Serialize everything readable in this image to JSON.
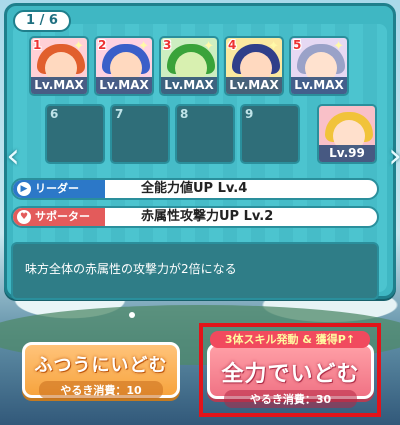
{
  "page_indicator": "1 / 6",
  "nav": {
    "left_arrow": "‹",
    "right_arrow": "›"
  },
  "members": [
    {
      "number": "1",
      "level": "Lv.MAX",
      "hair": "#e15f2d",
      "face": "#ffd9bf",
      "bg": "#ffd0d6"
    },
    {
      "number": "2",
      "level": "Lv.MAX",
      "hair": "#3a5fc9",
      "face": "#ffd9bf",
      "bg": "#ffd2e1"
    },
    {
      "number": "3",
      "level": "Lv.MAX",
      "hair": "#3aa33a",
      "face": "#d8f0b0",
      "bg": "#cdeec1"
    },
    {
      "number": "4",
      "level": "Lv.MAX",
      "hair": "#2f3f8a",
      "face": "#ffd9bf",
      "bg": "#fbe9a0"
    },
    {
      "number": "5",
      "level": "Lv.MAX",
      "hair": "#9aa2c8",
      "face": "#ffe2cf",
      "bg": "#e6d9f3"
    }
  ],
  "empty_slots": [
    "6",
    "7",
    "8",
    "9"
  ],
  "supporter_card": {
    "level": "Lv.99",
    "hair": "#f1c33a",
    "bg": "#f9c0c8"
  },
  "leader": {
    "tag": "リーダー",
    "icon": "▶",
    "skill": "全能力値UP Lv.4",
    "color": "#2c78c8"
  },
  "supporter": {
    "tag": "サポーター",
    "icon": "♥",
    "skill": "赤属性攻撃力UP Lv.2",
    "color": "#e35b5b"
  },
  "description": "味方全体の赤属性の攻撃力が2倍になる",
  "buttons": {
    "normal": {
      "label": "ふつうにいどむ",
      "cost": "やるき消費：10"
    },
    "full": {
      "banner": "3体スキル発動 & 獲得P↑",
      "label": "全力でいどむ",
      "cost": "やるき消費：30"
    }
  }
}
